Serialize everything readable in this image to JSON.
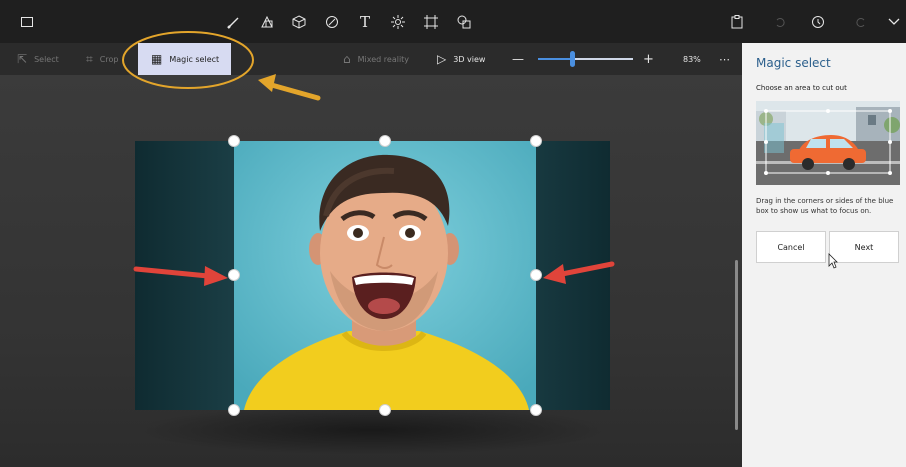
{
  "topbar": {
    "icons": [
      "window-icon",
      "brush-icon",
      "2d-shapes-icon",
      "3d-shapes-icon",
      "stickers-icon",
      "text-icon",
      "effects-icon",
      "canvas-icon",
      "3d-library-icon",
      "paste-icon",
      "undo-icon",
      "history-icon",
      "redo-icon",
      "expand-icon"
    ]
  },
  "toolbar": {
    "select_label": "Select",
    "crop_label": "Crop",
    "magic_select_label": "Magic select",
    "mixed_reality_label": "Mixed reality",
    "view_3d_label": "3D view",
    "zoom_minus": "—",
    "zoom_plus": "+",
    "zoom_value": "83%",
    "zoom_fraction": 0.36,
    "more": "⋯"
  },
  "panel": {
    "title": "Magic select",
    "subtitle": "Choose an area to cut out",
    "instructions": "Drag in the corners or sides of the blue box to show us what to focus on.",
    "cancel_label": "Cancel",
    "next_label": "Next"
  },
  "colors": {
    "topbar": "#1f1f1f",
    "toolbar": "#2b2b2b",
    "active_tool": "#d7dbf2",
    "panel_title": "#2b5f8c",
    "annotation_ellipse": "#e3a52b",
    "annotation_arrow_red": "#e0443a",
    "photo_bg": "#5cbccd",
    "shirt": "#f2cd1e"
  }
}
